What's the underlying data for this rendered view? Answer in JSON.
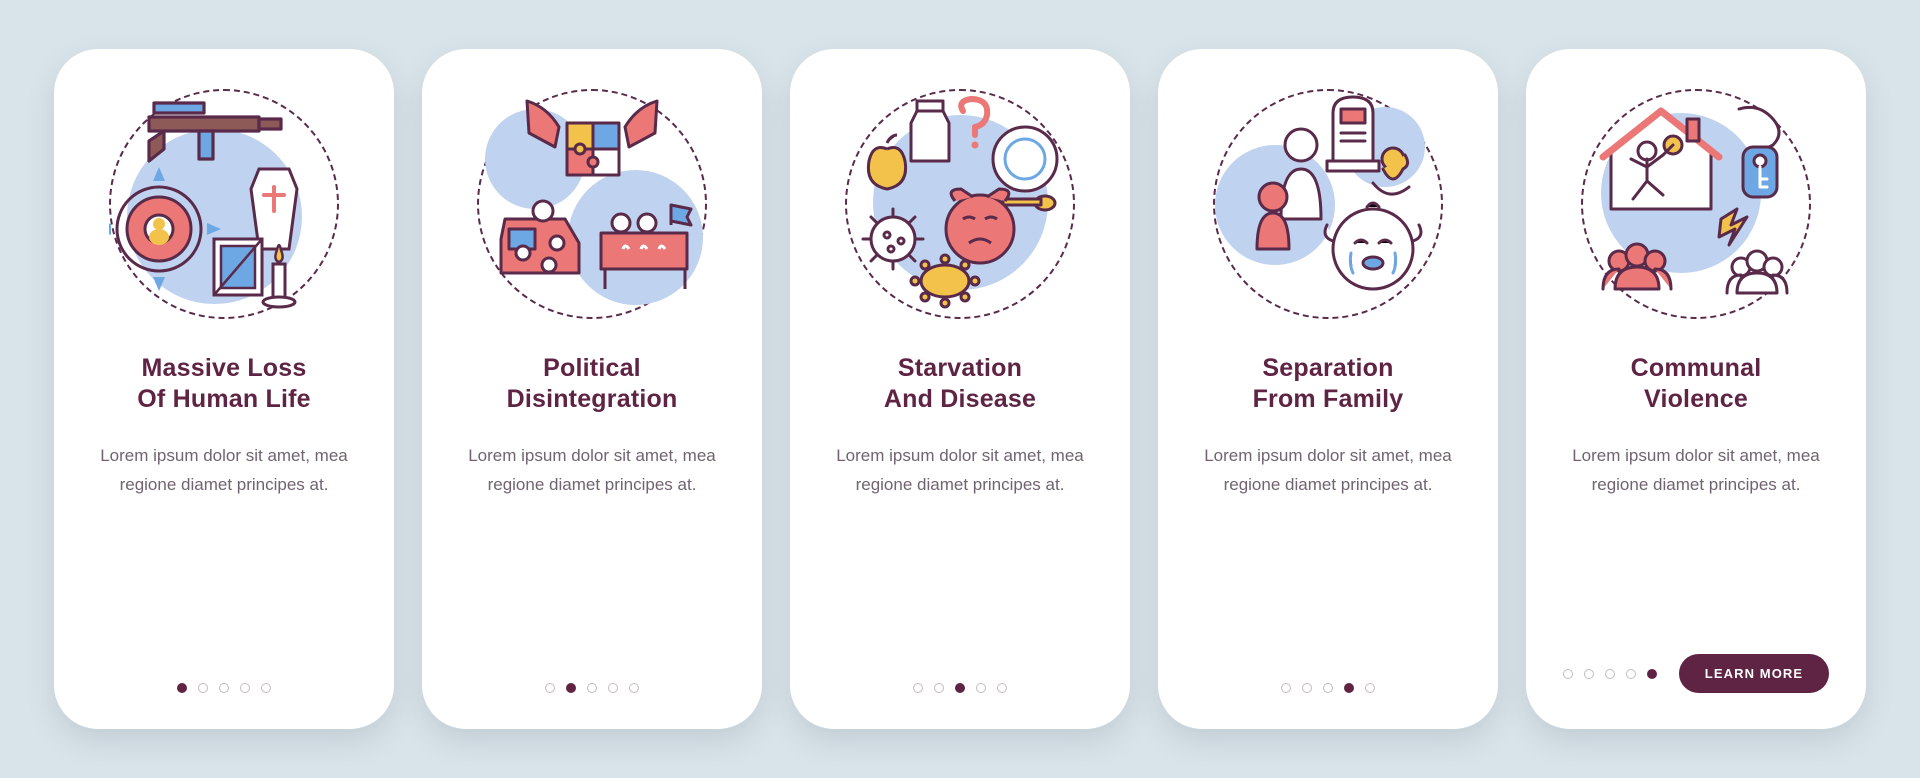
{
  "cta_label": "LEARN MORE",
  "placeholder": "Lorem ipsum dolor sit amet, mea regione diamet principes at.",
  "colors": {
    "outline": "#5a2a4a",
    "red": "#eb7777",
    "blue": "#6ea8e4",
    "yellow": "#f2c24b",
    "lblue": "#bfd2ef",
    "highlight": "#5f2443"
  },
  "cards": [
    {
      "id": "loss-of-life",
      "title": "Massive Loss\nOf Human Life",
      "title_line1": "Massive Loss",
      "title_line2": "Of Human Life",
      "desc": "Lorem ipsum dolor sit amet, mea regione diamet principes at.",
      "active_dot": 0,
      "illustration": "weapon-target-coffin-candle"
    },
    {
      "id": "political-disintegration",
      "title": "Political\nDisintegration",
      "title_line1": "Political",
      "title_line2": "Disintegration",
      "desc": "Lorem ipsum dolor sit amet, mea regione diamet principes at.",
      "active_dot": 1,
      "illustration": "hands-puzzle-protest"
    },
    {
      "id": "starvation-disease",
      "title": "Starvation\nAnd Disease",
      "title_line1": "Starvation",
      "title_line2": "And Disease",
      "desc": "Lorem ipsum dolor sit amet, mea regione diamet principes at.",
      "active_dot": 2,
      "illustration": "food-plate-germs-sad-face"
    },
    {
      "id": "separation-family",
      "title": "Separation\nFrom Family",
      "title_line1": "Separation",
      "title_line2": "From Family",
      "desc": "Lorem ipsum dolor sit amet, mea regione diamet principes at.",
      "active_dot": 3,
      "illustration": "parents-grave-baby-crying"
    },
    {
      "id": "communal-violence",
      "title": "Communal\nViolence",
      "title_line1": "Communal",
      "title_line2": "Violence",
      "desc": "Lorem ipsum dolor sit amet, mea regione diamet principes at.",
      "active_dot": 4,
      "illustration": "house-runner-key-groups-lightning",
      "has_cta": true
    }
  ]
}
